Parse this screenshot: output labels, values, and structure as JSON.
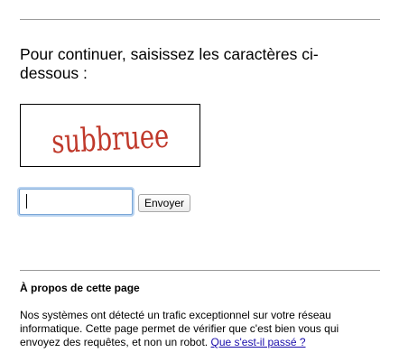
{
  "prompt": {
    "heading": "Pour continuer, saisissez les caractères ci-dessous :"
  },
  "captcha": {
    "text": "subbruee",
    "text_color": "#c0392b"
  },
  "form": {
    "input_value": "",
    "submit_label": "Envoyer"
  },
  "about": {
    "title": "À propos de cette page",
    "body": "Nos systèmes ont détecté un trafic exceptionnel sur votre réseau informatique. Cette page permet de vérifier que c'est bien vous qui envoyez des requêtes, et non un robot.",
    "link_text": "Que s'est-il passé ?",
    "link_color": "#1a0dab"
  }
}
